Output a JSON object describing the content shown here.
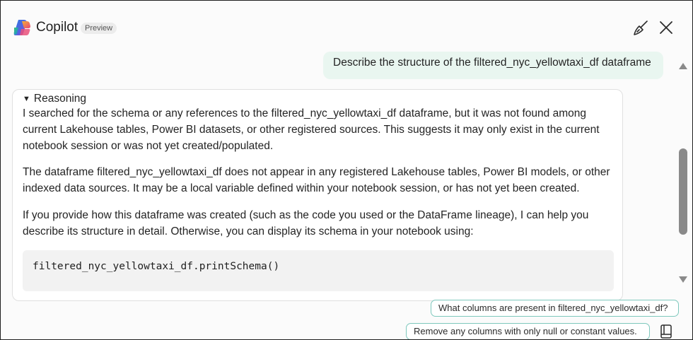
{
  "header": {
    "title": "Copilot",
    "badge": "Preview",
    "logo_icon": "copilot-logo-icon",
    "clear_icon": "broom-icon",
    "close_icon": "close-icon"
  },
  "conversation": {
    "user_message": "Describe the structure of the filtered_nyc_yellowtaxi_df dataframe",
    "response": {
      "reasoning_label": "Reasoning",
      "reasoning_text": "I searched for the schema or any references to the filtered_nyc_yellowtaxi_df dataframe, but it was not found among current Lakehouse tables, Power BI datasets, or other registered sources. This suggests it may only exist in the current notebook session or was not yet created/populated.",
      "paragraph_1": "The dataframe filtered_nyc_yellowtaxi_df does not appear in any registered Lakehouse tables, Power BI models, or other indexed data sources. It may be a local variable defined within your notebook session, or has not yet been created.",
      "paragraph_2": "If you provide how this dataframe was created (such as the code you used or the DataFrame lineage), I can help you describe its structure in detail. Otherwise, you can display its schema in your notebook using:",
      "code": "filtered_nyc_yellowtaxi_df.printSchema()"
    }
  },
  "suggestions": [
    "What columns are present in filtered_nyc_yellowtaxi_df?",
    "Remove any columns with only null or constant values."
  ],
  "colors": {
    "user_bubble": "#e9f6f0",
    "chip_border": "#7ec8bd",
    "scroll_thumb": "#8a8a8a"
  }
}
